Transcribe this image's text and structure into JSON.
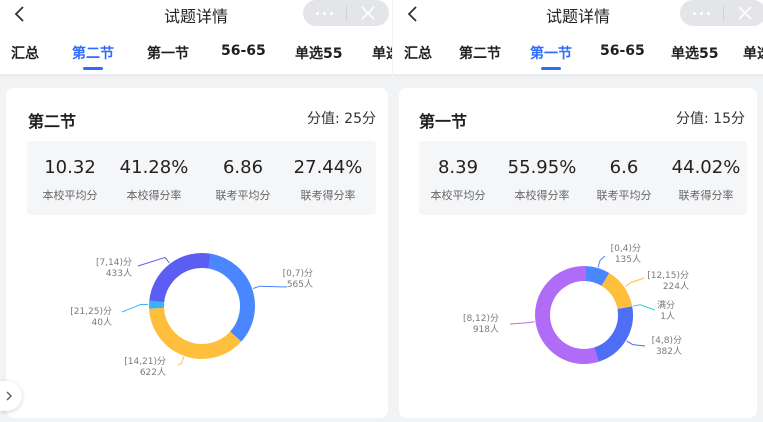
{
  "left": {
    "title": "试题详情",
    "tabs": [
      "汇总",
      "第二节",
      "第一节",
      "56-65",
      "单选55",
      "单选"
    ],
    "active_tab": "第二节",
    "card": {
      "title": "第二节",
      "score": "分值: 25分",
      "stats": [
        {
          "value": "10.32",
          "label": "本校平均分"
        },
        {
          "value": "41.28%",
          "label": "本校得分率"
        },
        {
          "value": "6.86",
          "label": "联考平均分"
        },
        {
          "value": "27.44%",
          "label": "联考得分率"
        }
      ],
      "chart_data": {
        "type": "pie",
        "unit": "人",
        "segments": [
          {
            "range": "[0,7)分",
            "count": "565人",
            "value": 565,
            "color": "#4a86ff"
          },
          {
            "range": "[14,21)分",
            "count": "622人",
            "value": 622,
            "color": "#ffbf3c"
          },
          {
            "range": "[21,25)分",
            "count": "40人",
            "value": 40,
            "color": "#39b4f7"
          },
          {
            "range": "[7,14)分",
            "count": "433人",
            "value": 433,
            "color": "#5b5df3"
          }
        ]
      }
    }
  },
  "right": {
    "title": "试题详情",
    "tabs": [
      "汇总",
      "第二节",
      "第一节",
      "56-65",
      "单选55",
      "单选"
    ],
    "active_tab": "第一节",
    "card": {
      "title": "第一节",
      "score": "分值: 15分",
      "stats": [
        {
          "value": "8.39",
          "label": "本校平均分"
        },
        {
          "value": "55.95%",
          "label": "本校得分率"
        },
        {
          "value": "6.6",
          "label": "联考平均分"
        },
        {
          "value": "44.02%",
          "label": "联考得分率"
        }
      ],
      "chart_data": {
        "type": "pie",
        "unit": "人",
        "segments": [
          {
            "range": "[0,4)分",
            "count": "135人",
            "value": 135,
            "color": "#4a86ff"
          },
          {
            "range": "[12,15)分",
            "count": "224人",
            "value": 224,
            "color": "#ffbf3c"
          },
          {
            "range": "满分",
            "count": "1人",
            "value": 1,
            "color": "#3ad0c5"
          },
          {
            "range": "[4,8)分",
            "count": "382人",
            "value": 382,
            "color": "#4d6ef5"
          },
          {
            "range": "[8,12)分",
            "count": "918人",
            "value": 918,
            "color": "#b06cf7"
          }
        ]
      }
    }
  }
}
